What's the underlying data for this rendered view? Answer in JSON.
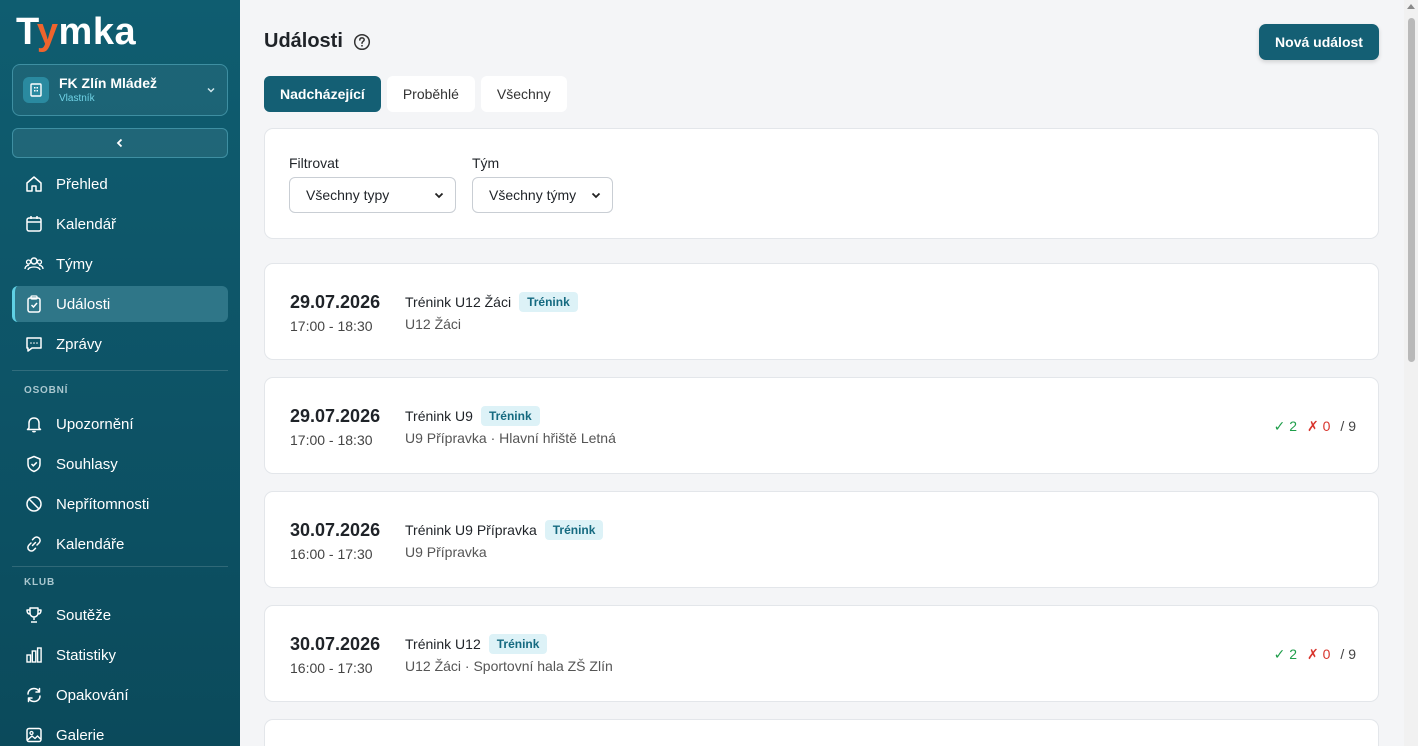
{
  "sidebar": {
    "logo_prefix": "T",
    "logo_accent": "y",
    "logo_suffix": "mka",
    "club": {
      "name": "FK Zlín Mládež",
      "role": "Vlastník"
    },
    "items": [
      {
        "label": "Přehled",
        "icon": "home-icon"
      },
      {
        "label": "Kalendář",
        "icon": "calendar-icon"
      },
      {
        "label": "Týmy",
        "icon": "users-icon"
      },
      {
        "label": "Události",
        "icon": "clipboard-icon",
        "active": true
      },
      {
        "label": "Zprávy",
        "icon": "chat-icon"
      }
    ],
    "personal_label": "OSOBNÍ",
    "personal_items": [
      {
        "label": "Upozornění",
        "icon": "bell-icon"
      },
      {
        "label": "Souhlasy",
        "icon": "shield-icon"
      },
      {
        "label": "Nepřítomnosti",
        "icon": "ban-icon"
      },
      {
        "label": "Kalendáře",
        "icon": "link-icon"
      }
    ],
    "club_label": "KLUB",
    "club_items": [
      {
        "label": "Soutěže",
        "icon": "trophy-icon"
      },
      {
        "label": "Statistiky",
        "icon": "chart-icon"
      },
      {
        "label": "Opakování",
        "icon": "repeat-icon"
      },
      {
        "label": "Galerie",
        "icon": "image-icon"
      }
    ]
  },
  "header": {
    "title": "Události",
    "new_button": "Nová událost"
  },
  "tabs": [
    "Nadcházející",
    "Proběhlé",
    "Všechny"
  ],
  "filters": {
    "filter_label": "Filtrovat",
    "filter_value": "Všechny typy",
    "team_label": "Tým",
    "team_value": "Všechny týmy"
  },
  "events": [
    {
      "date": "29.07.2026",
      "time": "17:00 - 18:30",
      "title": "Trénink U12 Žáci",
      "badge": "Trénink",
      "sub": "U12 Žáci",
      "stats": null
    },
    {
      "date": "29.07.2026",
      "time": "17:00 - 18:30",
      "title": "Trénink U9",
      "badge": "Trénink",
      "sub": "U9 Přípravka · Hlavní hřiště Letná",
      "stats": {
        "ok": "✓ 2",
        "no": "✗ 0",
        "total": "/ 9"
      }
    },
    {
      "date": "30.07.2026",
      "time": "16:00 - 17:30",
      "title": "Trénink U9 Přípravka",
      "badge": "Trénink",
      "sub": "U9 Přípravka",
      "stats": null
    },
    {
      "date": "30.07.2026",
      "time": "16:00 - 17:30",
      "title": "Trénink U12",
      "badge": "Trénink",
      "sub": "U12 Žáci · Sportovní hala ZŠ Zlín",
      "stats": {
        "ok": "✓ 2",
        "no": "✗ 0",
        "total": "/ 9"
      }
    }
  ],
  "colors": {
    "sidebar": "#0f5d70",
    "primary": "#145f74",
    "accent": "#f0642d",
    "success": "#1e9e4a",
    "danger": "#d8342c"
  }
}
